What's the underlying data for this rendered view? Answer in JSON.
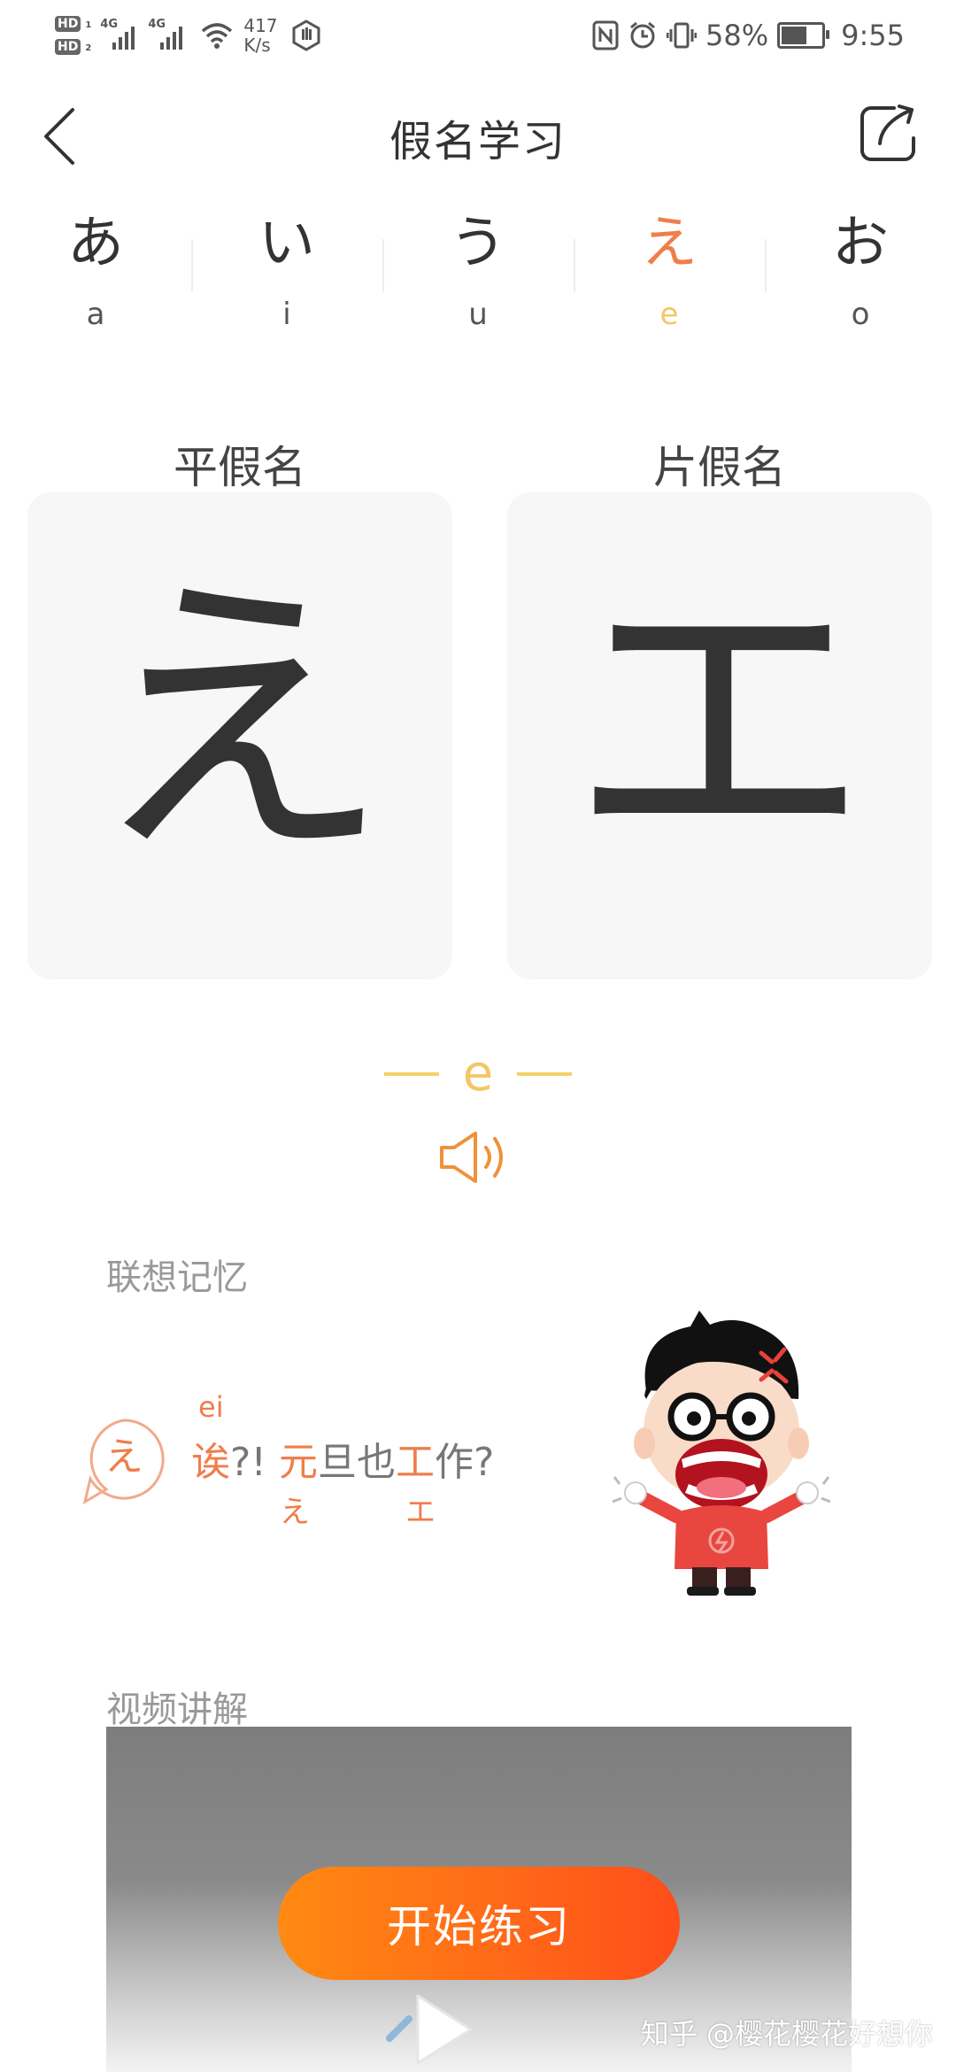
{
  "status_bar": {
    "hd1": "HD",
    "hd1_sub": "1",
    "hd2": "HD",
    "hd2_sub": "2",
    "network1": "4G",
    "network2": "4G",
    "speed_value": "417",
    "speed_unit": "K/s",
    "battery_percent": "58%",
    "battery_level": 0.58,
    "time": "9:55"
  },
  "header": {
    "title": "假名学习",
    "back_icon": "chevron-left-icon",
    "share_icon": "share-icon"
  },
  "kana_tabs": [
    {
      "kana": "あ",
      "romaji": "a",
      "active": false
    },
    {
      "kana": "い",
      "romaji": "i",
      "active": false
    },
    {
      "kana": "う",
      "romaji": "u",
      "active": false
    },
    {
      "kana": "え",
      "romaji": "e",
      "active": true
    },
    {
      "kana": "お",
      "romaji": "o",
      "active": false
    }
  ],
  "cards": {
    "hiragana_label": "平假名",
    "hiragana_char": "え",
    "katakana_label": "片假名",
    "katakana_char": "エ"
  },
  "pronunciation": {
    "romaji": "e",
    "sound_icon": "speaker-icon"
  },
  "memory": {
    "section_label": "联想记忆",
    "bubble_char": "え",
    "ruby": "ei",
    "sentence_hl1": "诶",
    "sentence_part2": "?!",
    "sentence_hl2": "元",
    "sentence_part3": "旦也",
    "sentence_hl3": "工",
    "sentence_part4": "作?",
    "under_hiragana": "え",
    "under_katakana": "エ"
  },
  "video": {
    "section_label": "视频讲解",
    "play_icon": "play-icon"
  },
  "start_button": "开始练习",
  "watermark": "知乎 @樱花樱花好想你",
  "colors": {
    "accent_orange": "#ef7e4b",
    "accent_yellow": "#f3c766",
    "button_start": "#ff8a12",
    "button_end": "#ff4d1a",
    "card_bg": "#f7f7f7"
  }
}
